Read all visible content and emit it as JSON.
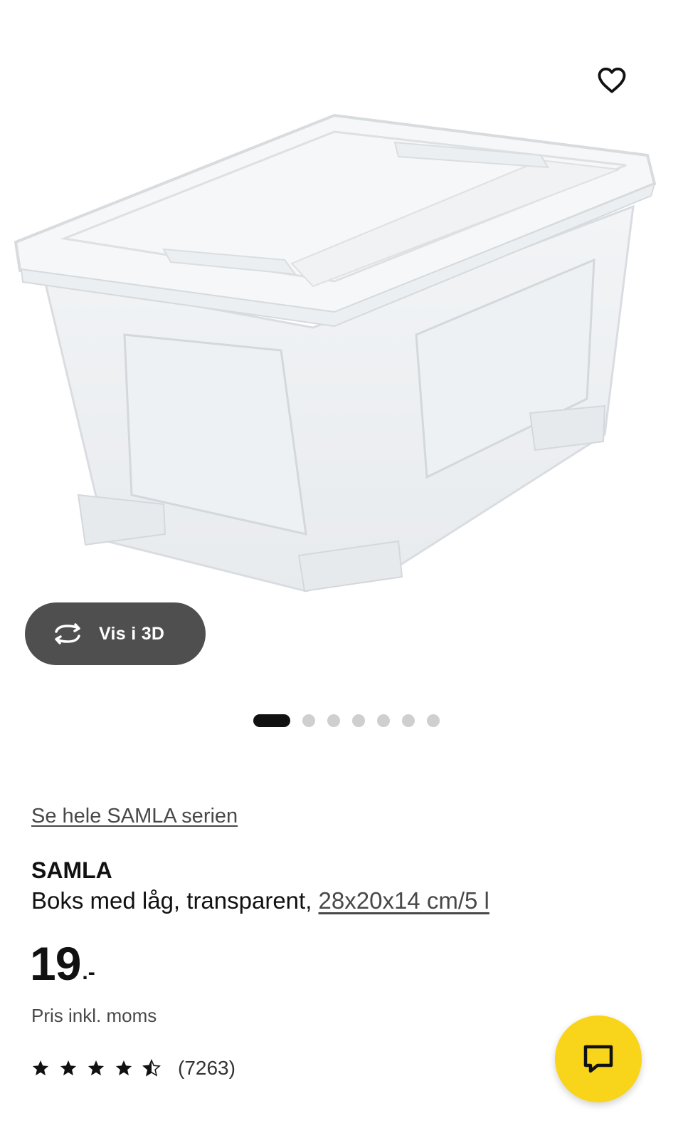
{
  "gallery": {
    "image_alt": "SAMLA Boks med låg, transparent",
    "favorite_icon": "heart-outline-icon",
    "view3d": {
      "label": "Vis i 3D",
      "icon": "rotate-3d-icon"
    },
    "pager": {
      "total": 7,
      "active_index": 0
    }
  },
  "product": {
    "series_link": "Se hele SAMLA serien",
    "name": "SAMLA",
    "description": "Boks med låg, transparent, ",
    "measure": "28x20x14 cm/5 l",
    "price": {
      "integer": "19",
      "suffix": ".-"
    },
    "vat_note": "Pris inkl. moms",
    "rating": {
      "stars": 4.5,
      "max": 5,
      "review_count": "(7263)"
    }
  },
  "chat": {
    "icon": "chat-bubble-icon"
  },
  "colors": {
    "accent_yellow": "#f8d51a",
    "dark_button": "#4f4f4f",
    "text": "#111111",
    "muted": "#484848"
  }
}
